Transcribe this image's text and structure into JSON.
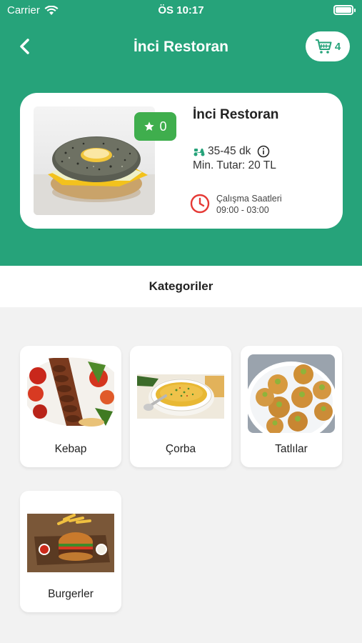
{
  "status_bar": {
    "carrier": "Carrier",
    "time": "ÖS 10:17"
  },
  "header": {
    "title": "İnci Restoran",
    "cart_count": "4"
  },
  "restaurant": {
    "name": "İnci Restoran",
    "rating": "0",
    "delivery_time": "35-45 dk",
    "min_amount": "Min. Tutar: 20 TL",
    "hours_label": "Çalışma Saatleri",
    "hours_value": "09:00 - 03:00"
  },
  "categories_title": "Kategoriler",
  "categories": [
    {
      "label": "Kebap"
    },
    {
      "label": "Çorba"
    },
    {
      "label": "Tatlılar"
    },
    {
      "label": "Burgerler"
    }
  ],
  "colors": {
    "primary": "#26a37a",
    "rating": "#3fae4d",
    "clock": "#e53935"
  }
}
